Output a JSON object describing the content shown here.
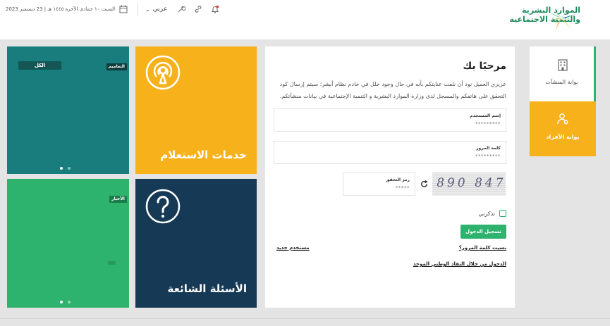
{
  "header": {
    "logo": {
      "line1": "الموارد البشرية",
      "line2": "والتنمية الاجتماعية"
    },
    "date": "السبت ١٠ جمادى الآخرة ١٤٤٥ هـ | 23 ديسمبر 2023",
    "language": "عربي",
    "icons": [
      "calendar-icon",
      "chevron-down-icon",
      "tools-icon",
      "link-icon",
      "notification-bell-icon"
    ]
  },
  "tiles": {
    "teal": {
      "pill": "الكل",
      "badge": "التعاميم"
    },
    "green": {
      "badge": "الأخبار"
    },
    "inquiry": {
      "title": "خدمات الاستعلام",
      "icon": "broadcast-icon"
    },
    "faq": {
      "title": "الأسئلة الشائعة",
      "icon": "question-icon"
    }
  },
  "login": {
    "welcome": "مرحبًا بك",
    "intro": "عزيزي العميل نود أن نلفت عنايتكم بأنه في حال وجود خلل في خادم نظام أبشر؛ سيتم إرسال كود التحقق على هاتفكم والمسجل لدى وزارة الموارد البشرية و التنمية الإجتماعية في بيانات منشآتكم.",
    "username": {
      "label": "إسم المستخدم",
      "value": "*********"
    },
    "password": {
      "label": "كلمة المرور",
      "value": "*********"
    },
    "captcha": {
      "label": "رمز التحقق",
      "value": "*****",
      "image_text": "890 847"
    },
    "remember": "تذكرني",
    "submit": "تسجيل الدخول",
    "forgot": "نسيت كلمة المرور؟",
    "new_user": "مستخدم جديد",
    "nafath": "الدخول من خلال النفاذ الوطني الموحد"
  },
  "portals": {
    "establishments": "بوابة المنشآت",
    "individuals": "بوابة الأفراد"
  },
  "colors": {
    "teal": "#1a7d7d",
    "yellow": "#f7b21b",
    "green": "#2eb36e",
    "navy": "#163a55"
  }
}
